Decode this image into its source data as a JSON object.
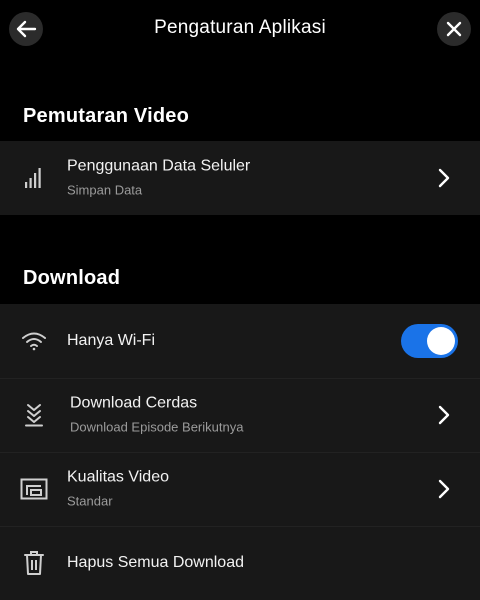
{
  "header": {
    "title": "Pengaturan Aplikasi",
    "back_icon": "arrow-left-icon",
    "close_icon": "close-icon"
  },
  "sections": {
    "video_playback": {
      "heading": "Pemutaran Video",
      "mobile_data": {
        "title": "Penggunaan Data Seluler",
        "subtitle": "Simpan Data",
        "icon": "signal-bars-icon"
      }
    },
    "download": {
      "heading": "Download",
      "wifi_only": {
        "title": "Hanya Wi-Fi",
        "icon": "wifi-icon",
        "enabled": true
      },
      "smart_download": {
        "title": "Download Cerdas",
        "subtitle": "Download Episode Berikutnya",
        "icon": "smart-download-icon"
      },
      "video_quality": {
        "title": "Kualitas Video",
        "subtitle": "Standar",
        "icon": "video-quality-icon"
      },
      "delete_all": {
        "title": "Hapus Semua Download",
        "icon": "trash-icon"
      }
    }
  },
  "colors": {
    "background": "#000000",
    "row_background": "#181818",
    "toggle_on": "#1a73e8",
    "subtitle": "#9b9b9b"
  }
}
